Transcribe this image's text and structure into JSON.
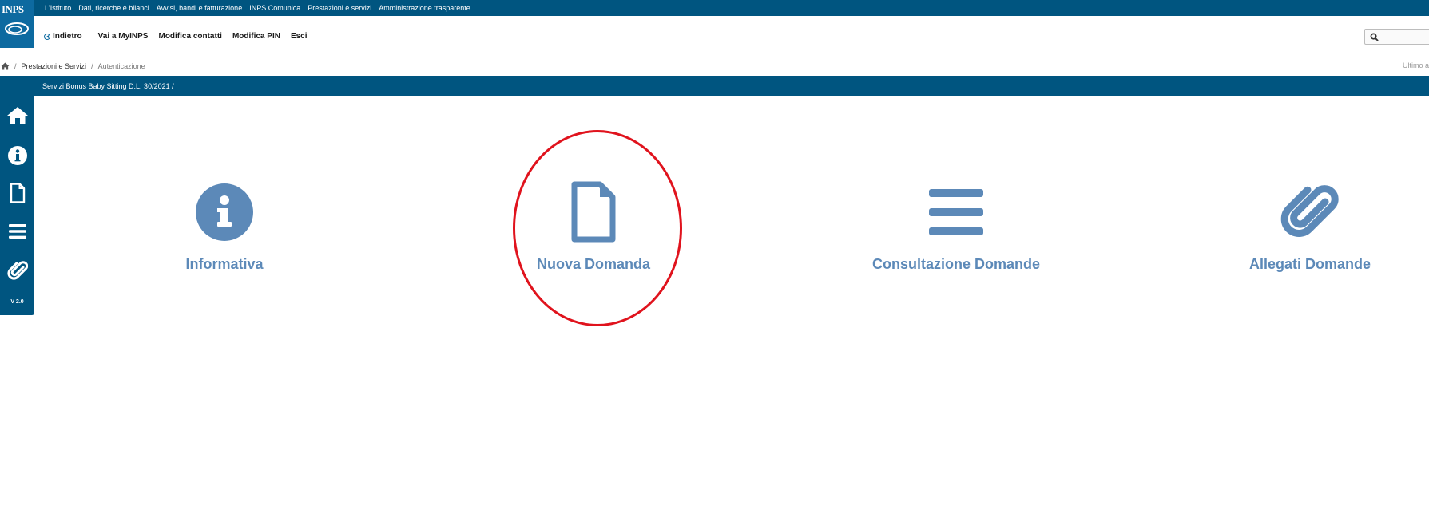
{
  "brand": {
    "logo_text": "INPS"
  },
  "top_links": [
    "L'Istituto",
    "Dati, ricerche e bilanci",
    "Avvisi, bandi e fatturazione",
    "INPS Comunica",
    "Prestazioni e servizi",
    "Amministrazione trasparente"
  ],
  "nav": {
    "back_label": "Indietro",
    "items": [
      "Vai a MyINPS",
      "Modifica contatti",
      "Modifica PIN",
      "Esci"
    ]
  },
  "search": {
    "placeholder": "",
    "icon": "search-icon"
  },
  "breadcrumb": {
    "home_icon": "home-icon",
    "link": "Prestazioni e Servizi",
    "current": "Autenticazione",
    "right_text": "Ultimo a"
  },
  "service": {
    "title": "Servizi Bonus Baby Sitting D.L. 30/2021  /"
  },
  "sidebar": {
    "icons": [
      "home-icon",
      "info-icon",
      "document-icon",
      "list-icon",
      "paperclip-icon"
    ],
    "version": "V 2.0"
  },
  "cards": [
    {
      "label": "Informativa",
      "icon": "info-circle-icon"
    },
    {
      "label": "Nuova Domanda",
      "icon": "document-icon"
    },
    {
      "label": "Consultazione Domande",
      "icon": "list-icon"
    },
    {
      "label": "Allegati Domande",
      "icon": "paperclip-icon"
    }
  ],
  "colors": {
    "primary_bar": "#005580",
    "icon_blue": "#5c89b8",
    "highlight_red": "#e0131d"
  }
}
